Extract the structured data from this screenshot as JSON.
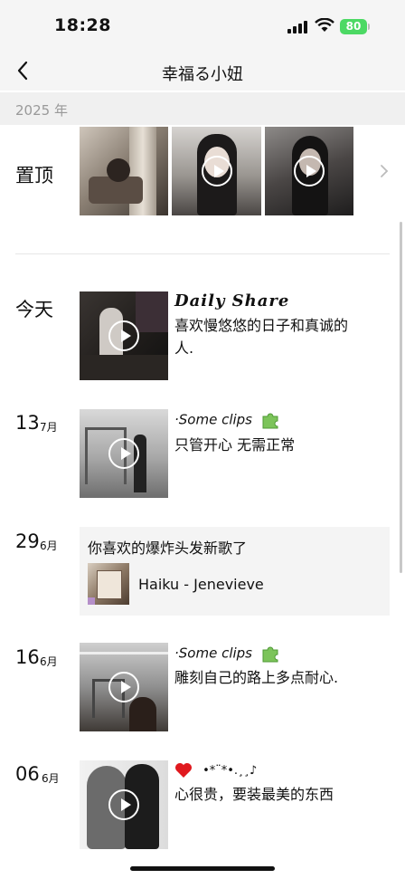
{
  "status": {
    "time": "18:28",
    "battery": "80"
  },
  "nav": {
    "title": "幸福る小妞"
  },
  "year": "2025 年",
  "pinned": {
    "label": "置顶",
    "thumbs": [
      {
        "type": "photo"
      },
      {
        "type": "video"
      },
      {
        "type": "video"
      }
    ]
  },
  "posts": [
    {
      "date_word": "今天",
      "title": "Daily  Share",
      "text_lines": [
        "喜欢慢悠悠的日子和真诚的",
        "人."
      ],
      "media": "video"
    },
    {
      "day": "13",
      "month": "7月",
      "tag": "·Some clips",
      "text": "只管开心 无需正常",
      "media": "video"
    },
    {
      "day": "29",
      "month": "6月",
      "caption": "你喜欢的爆炸头发新歌了",
      "music_title": "Haiku - Jenevieve",
      "media": "music"
    },
    {
      "day": "16",
      "month": "6月",
      "tag": "·Some clips",
      "text": "雕刻自己的路上多点耐心.",
      "media": "video"
    },
    {
      "day": "06",
      "month": "6月",
      "decor": "•*¨*•.¸¸♪",
      "text": "心很贵，要装最美的东西",
      "media": "video"
    }
  ],
  "icons": {
    "back": "chevron-left-icon",
    "more": "chevron-right-icon",
    "play": "play-icon",
    "puzzle": "puzzle-piece-icon",
    "heart": "heart-icon"
  }
}
